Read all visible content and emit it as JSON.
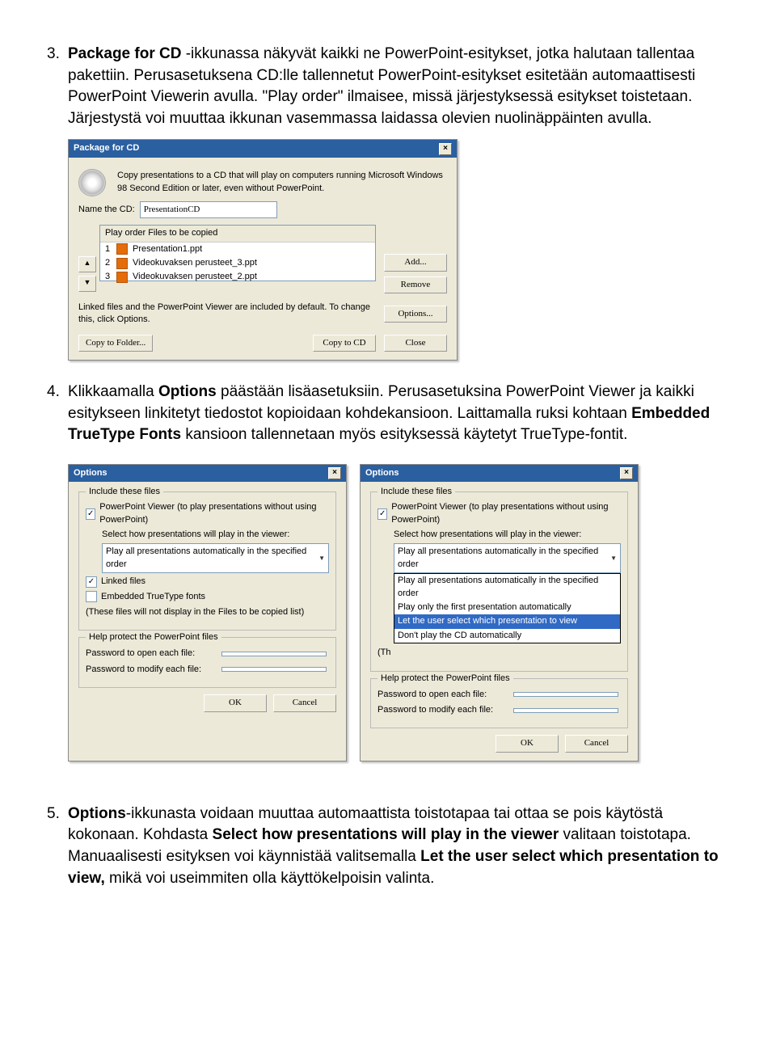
{
  "para3": {
    "num": "3.",
    "t1a": "Package for CD",
    "t1b": " -ikkunassa näkyvät kaikki ne PowerPoint-esitykset, jotka halutaan tallentaa pakettiin. Perusasetuksena CD:lle tallennetut PowerPoint-esitykset esitetään automaattisesti PowerPoint Viewerin avulla. \"Play order\" ilmaisee, missä järjestyksessä esitykset toistetaan. Järjestystä voi muuttaa ikkunan vasemmassa laidassa olevien nuolinäppäinten avulla."
  },
  "pkg": {
    "title": "Package for CD",
    "desc": "Copy presentations to a CD that will play on computers running Microsoft Windows 98 Second Edition or later, even without PowerPoint.",
    "nameLbl": "Name the CD:",
    "nameVal": "PresentationCD",
    "head": "Play order    Files to be copied",
    "rows": [
      {
        "n": "1",
        "f": "Presentation1.ppt"
      },
      {
        "n": "2",
        "f": "Videokuvaksen perusteet_3.ppt"
      },
      {
        "n": "3",
        "f": "Videokuvaksen perusteet_2.ppt"
      }
    ],
    "add": "Add...",
    "remove": "Remove",
    "linked": "Linked files and the PowerPoint Viewer are included by default. To change this, click Options.",
    "options": "Options...",
    "copyF": "Copy to Folder...",
    "copyCD": "Copy to CD",
    "close": "Close"
  },
  "para4": {
    "num": "4.",
    "t1": "Klikkaamalla ",
    "b1": "Options",
    "t2": " päästään lisäasetuksiin. Perusasetuksina PowerPoint Viewer ja kaikki esitykseen linkitetyt tiedostot kopioidaan kohdekansioon. Laittamalla ruksi kohtaan ",
    "b2": "Embedded TrueType Fonts",
    "t3": " kansioon tallennetaan myös esityksessä käytetyt TrueType-fontit."
  },
  "opt": {
    "title": "Options",
    "fs1": "Include these files",
    "pv": "PowerPoint Viewer (to play presentations without using PowerPoint)",
    "selLbl": "Select how presentations will play in the viewer:",
    "selVal": "Play all presentations automatically in the specified order",
    "linked": "Linked files",
    "emb": "Embedded TrueType fonts",
    "note": "(These files will not display in the Files to be copied list)",
    "noteB": "(Th",
    "fs2": "Help protect the PowerPoint files",
    "pw1": "Password to open each file:",
    "pw2": "Password to modify each file:",
    "ok": "OK",
    "cancel": "Cancel",
    "drop": [
      "Play all presentations automatically in the specified order",
      "Play only the first presentation automatically",
      "Let the user select which presentation to view",
      "Don't play the CD automatically"
    ]
  },
  "para5": {
    "num": "5.",
    "b1": "Options",
    "t1": "-ikkunasta voidaan muuttaa automaattista toistotapaa tai ottaa se pois käytöstä kokonaan. Kohdasta ",
    "b2": "Select how presentations will play in the viewer",
    "t2": " valitaan toistotapa. Manuaalisesti esityksen voi käynnistää valitsemalla ",
    "b3": "Let the user select which presentation to view,",
    "t3": " mikä voi useimmiten olla käyttökelpoisin valinta."
  }
}
